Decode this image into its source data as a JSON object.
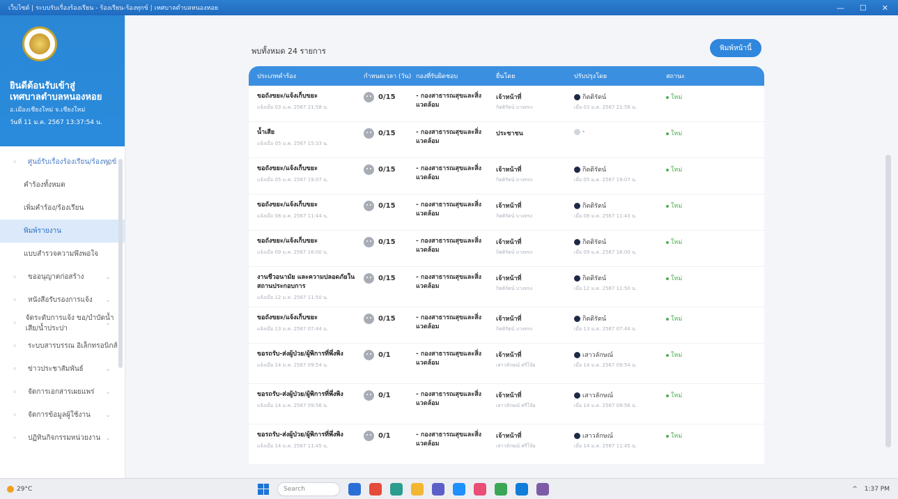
{
  "window": {
    "title": "เว็บไซต์ | ระบบรับเรื่องร้องเรียน - ร้องเรียน-ร้องทุกข์ | เทศบาลตำบลหนองหอย",
    "controls": [
      "—",
      "☐",
      "✕"
    ]
  },
  "sidebar": {
    "org_title_1": "ยินดีต้อนรับเข้าสู่",
    "org_title_2": "เทศบาลตำบลหนองหอย",
    "org_sub": "อ.เมืองเชียงใหม่ จ.เชียงใหม่",
    "date": "วันที่ 11 ม.ค. 2567 13:37:54 น.",
    "items": [
      {
        "label": "ศูนย์รับเรื่องร้องเรียน/ร้องทุกข์",
        "icon": "headset-icon",
        "group": true,
        "chevron": "▲"
      },
      {
        "label": "คำร้องทั้งหมด",
        "sub": true
      },
      {
        "label": "เพิ่มคำร้อง/ร้องเรียน",
        "sub": true
      },
      {
        "label": "พิมพ์รายงาน",
        "sub": true,
        "active": true
      },
      {
        "label": "แบบสำรวจความพึงพอใจ",
        "sub": true
      },
      {
        "label": "ขออนุญาตก่อสร้าง",
        "icon": "person-icon",
        "chevron": "⌄"
      },
      {
        "label": "หนังสือรับรองการแจ้ง",
        "icon": "mail-icon",
        "chevron": "⌄"
      },
      {
        "label": "จัดระดับการแจ้ง ขอ/บำบัดน้ำเสีย/น้ำประปา",
        "icon": "document-icon",
        "chevron": "⌄"
      },
      {
        "label": "ระบบสารบรรณ อิเล็กทรอนิกส์",
        "icon": "inbox-icon",
        "chevron": "⌄"
      },
      {
        "label": "ข่าวประชาสัมพันธ์",
        "icon": "megaphone-icon",
        "chevron": "⌄"
      },
      {
        "label": "จัดการเอกสารเผยแพร่",
        "icon": "file-icon",
        "chevron": "⌄"
      },
      {
        "label": "จัดการข้อมูลผู้ใช้งาน",
        "icon": "users-icon",
        "chevron": "⌄"
      },
      {
        "label": "ปฏิทินกิจกรรมหน่วยงาน",
        "icon": "calendar-icon",
        "chevron": "⌄"
      }
    ]
  },
  "main": {
    "count_text": "พบทั้งหมด 24 รายการ",
    "print_button": "พิมพ์หน้านี้",
    "columns": [
      "ประเภทคำร้อง",
      "กำหนดเวลา (วัน)",
      "กองที่รับผิดชอบ",
      "ยื่นโดย",
      "ปรับปรุงโดย",
      "สถานะ"
    ],
    "rows": [
      {
        "type": "ขอถังขยะ/แจ้งเก็บขยะ",
        "date": "แจ้งเมื่อ 03 ม.ค. 2567 21:58 น.",
        "days": "0/15",
        "dept": "- กองสาธารณสุขและสิ่งแวดล้อม",
        "by": "เจ้าหน้าที่",
        "by_sub": "กิตติรัตน์ บางทรง",
        "updater": "กิตติรัตน์",
        "upd_sub": "เมื่อ 03 ม.ค. 2567 21:58 น.",
        "status": "ใหม่"
      },
      {
        "type": "น้ำเสีย",
        "date": "แจ้งเมื่อ 05 ม.ค. 2567 15:33 น.",
        "days": "0/15",
        "dept": "- กองสาธารณสุขและสิ่งแวดล้อม",
        "by": "ประชาชน",
        "by_sub": "",
        "updater": "-",
        "upd_sub": "",
        "status": "ใหม่"
      },
      {
        "type": "ขอถังขยะ/แจ้งเก็บขยะ",
        "date": "แจ้งเมื่อ 05 ม.ค. 2567 19:07 น.",
        "days": "0/15",
        "dept": "- กองสาธารณสุขและสิ่งแวดล้อม",
        "by": "เจ้าหน้าที่",
        "by_sub": "กิตติรัตน์ บางทรง",
        "updater": "กิตติรัตน์",
        "upd_sub": "เมื่อ 05 ม.ค. 2567 19:07 น.",
        "status": "ใหม่"
      },
      {
        "type": "ขอถังขยะ/แจ้งเก็บขยะ",
        "date": "แจ้งเมื่อ 08 ม.ค. 2567 11:44 น.",
        "days": "0/15",
        "dept": "- กองสาธารณสุขและสิ่งแวดล้อม",
        "by": "เจ้าหน้าที่",
        "by_sub": "กิตติรัตน์ บางทรง",
        "updater": "กิตติรัตน์",
        "upd_sub": "เมื่อ 08 ม.ค. 2567 11:43 น.",
        "status": "ใหม่"
      },
      {
        "type": "ขอถังขยะ/แจ้งเก็บขยะ",
        "date": "แจ้งเมื่อ 09 ม.ค. 2567 16:00 น.",
        "days": "0/15",
        "dept": "- กองสาธารณสุขและสิ่งแวดล้อม",
        "by": "เจ้าหน้าที่",
        "by_sub": "กิตติรัตน์ บางทรง",
        "updater": "กิตติรัตน์",
        "upd_sub": "เมื่อ 09 ม.ค. 2567 16:00 น.",
        "status": "ใหม่"
      },
      {
        "type": "งานชีวอนามัย และความปลอดภัยในสถานประกอบการ",
        "date": "แจ้งเมื่อ 12 ม.ค. 2567 11:50 น.",
        "days": "0/15",
        "dept": "- กองสาธารณสุขและสิ่งแวดล้อม",
        "by": "เจ้าหน้าที่",
        "by_sub": "กิตติรัตน์ บางทรง",
        "updater": "กิตติรัตน์",
        "upd_sub": "เมื่อ 12 ม.ค. 2567 11:50 น.",
        "status": "ใหม่"
      },
      {
        "type": "ขอถังขยะ/แจ้งเก็บขยะ",
        "date": "แจ้งเมื่อ 13 ม.ค. 2567 07:44 น.",
        "days": "0/15",
        "dept": "- กองสาธารณสุขและสิ่งแวดล้อม",
        "by": "เจ้าหน้าที่",
        "by_sub": "กิตติรัตน์ บางทรง",
        "updater": "กิตติรัตน์",
        "upd_sub": "เมื่อ 13 ม.ค. 2567 07:44 น.",
        "status": "ใหม่"
      },
      {
        "type": "ขอรถรับ-ส่งผู้ป่วย/ผู้พิการที่พึ่งพิง",
        "date": "แจ้งเมื่อ 14 ม.ค. 2567 09:54 น.",
        "days": "0/1",
        "dept": "- กองสาธารณสุขและสิ่งแวดล้อม",
        "by": "เจ้าหน้าที่",
        "by_sub": "เสาวลักษณ์ ศรีโจ้ย",
        "updater": "เสาวลักษณ์",
        "upd_sub": "เมื่อ 14 ม.ค. 2567 09:54 น.",
        "status": "ใหม่"
      },
      {
        "type": "ขอรถรับ-ส่งผู้ป่วย/ผู้พิการที่พึ่งพิง",
        "date": "แจ้งเมื่อ 14 ม.ค. 2567 09:56 น.",
        "days": "0/1",
        "dept": "- กองสาธารณสุขและสิ่งแวดล้อม",
        "by": "เจ้าหน้าที่",
        "by_sub": "เสาวลักษณ์ ศรีโจ้ย",
        "updater": "เสาวลักษณ์",
        "upd_sub": "เมื่อ 14 ม.ค. 2567 09:56 น.",
        "status": "ใหม่"
      },
      {
        "type": "ขอรถรับ-ส่งผู้ป่วย/ผู้พิการที่พึ่งพิง",
        "date": "แจ้งเมื่อ 14 ม.ค. 2567 11:45 น.",
        "days": "0/1",
        "dept": "- กองสาธารณสุขและสิ่งแวดล้อม",
        "by": "เจ้าหน้าที่",
        "by_sub": "เสาวลักษณ์ ศรีโจ้ย",
        "updater": "เสาวลักษณ์",
        "upd_sub": "เมื่อ 14 ม.ค. 2567 11:45 น.",
        "status": "ใหม่"
      }
    ]
  },
  "taskbar": {
    "weather": "29°C",
    "search": "Search",
    "time": "1:37 PM",
    "apps": [
      "#2b6fd6",
      "#e44b3a",
      "#2a9d8f",
      "#f2b632",
      "#5b5fc7",
      "#1e90ff",
      "#e94e77",
      "#3aa655",
      "#0f7dd9",
      "#7d5ba6"
    ]
  },
  "colors": {
    "accent": "#2f86dc",
    "status": "#4caf50"
  }
}
